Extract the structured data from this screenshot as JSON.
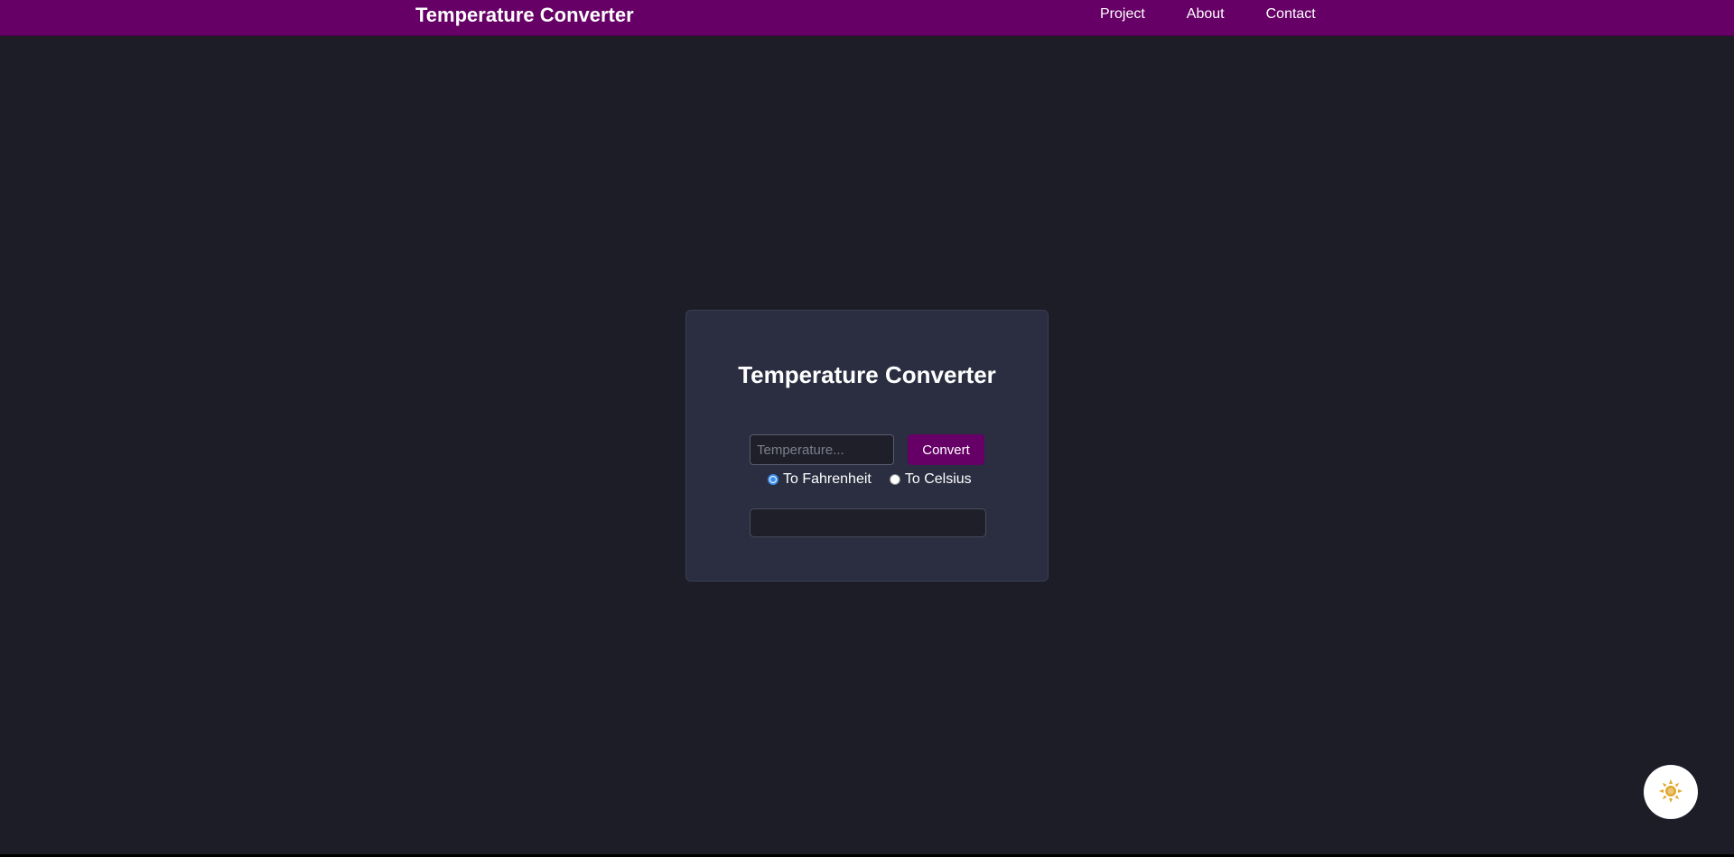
{
  "navbar": {
    "brand": "Temperature Converter",
    "links": [
      "Project",
      "About",
      "Contact"
    ],
    "color": "#660066"
  },
  "converter": {
    "title": "Temperature Converter",
    "input_placeholder": "Temperature...",
    "input_value": "",
    "convert_label": "Convert",
    "options": [
      {
        "label": "To Fahrenheit",
        "checked": true
      },
      {
        "label": "To Celsius",
        "checked": false
      }
    ],
    "result": ""
  },
  "theme_toggle": {
    "icon": "sun-icon",
    "icon_color": "#e0a82e"
  },
  "colors": {
    "background": "#1c1d27",
    "card": "#2a2e40",
    "accent": "#660066"
  }
}
